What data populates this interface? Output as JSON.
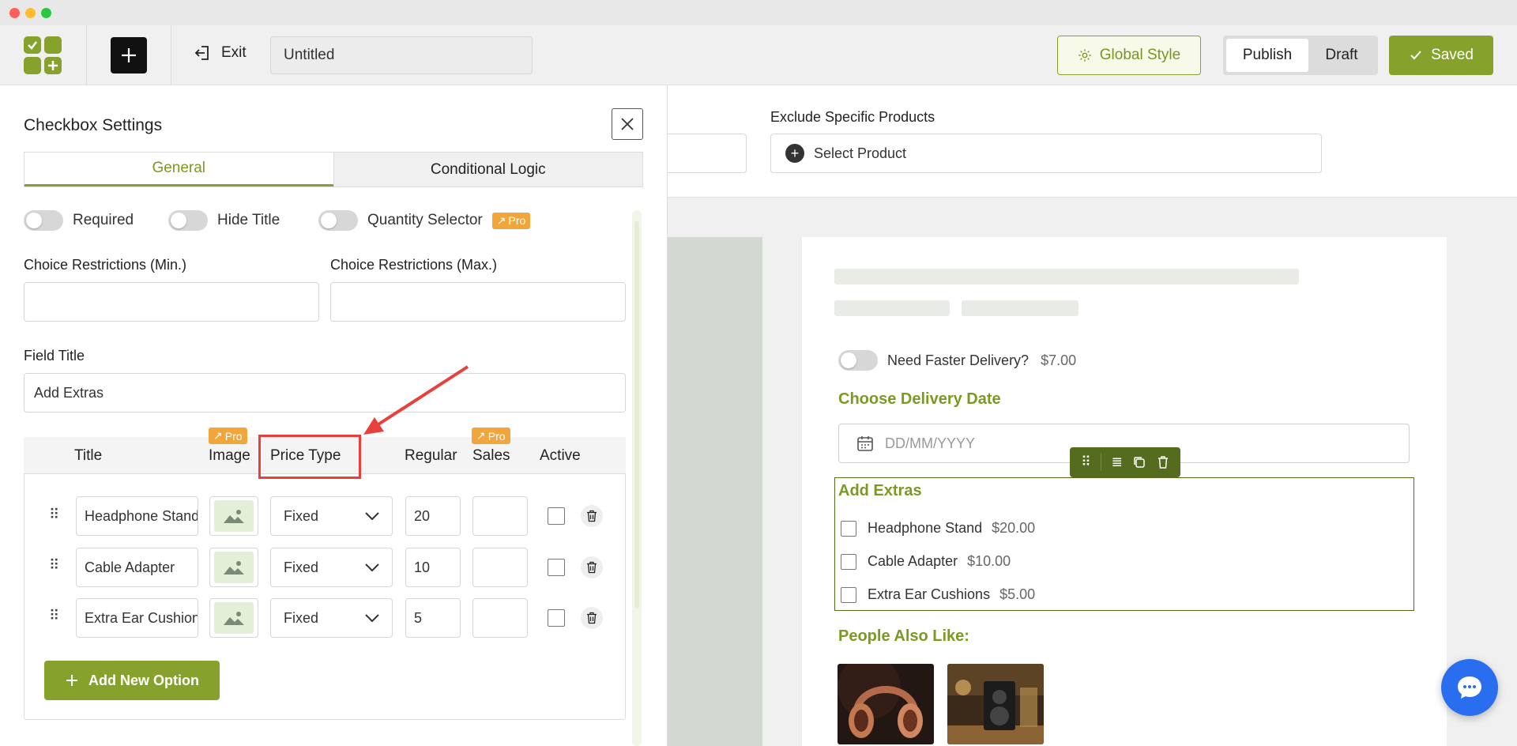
{
  "window": {
    "traffic_lights": [
      "#ff5f57",
      "#febc2e",
      "#28c840"
    ]
  },
  "topbar": {
    "exit_label": "Exit",
    "document_title": "Untitled",
    "global_style_label": "Global Style",
    "publish_label": "Publish",
    "draft_label": "Draft",
    "saved_label": "Saved"
  },
  "colors": {
    "accent": "#87a22c",
    "accent_dark": "#556b1e",
    "pro_badge": "#f0a63a",
    "highlight": "#e8403a",
    "chat": "#2a6ef0"
  },
  "filters": {
    "exclude_label": "Exclude Specific Products",
    "select_product_placeholder": "Select Product"
  },
  "panel": {
    "title": "Checkbox Settings",
    "tabs": [
      {
        "label": "General",
        "active": true
      },
      {
        "label": "Conditional Logic",
        "active": false
      }
    ],
    "toggles": [
      {
        "label": "Required",
        "on": false
      },
      {
        "label": "Hide Title",
        "on": false
      },
      {
        "label": "Quantity Selector",
        "on": false,
        "badge": "Pro"
      }
    ],
    "choice_min_label": "Choice Restrictions (Min.)",
    "choice_min_value": "",
    "choice_max_label": "Choice Restrictions (Max.)",
    "choice_max_value": "",
    "field_title_label": "Field Title",
    "field_title_value": "Add Extras",
    "table": {
      "headers": {
        "title": "Title",
        "image": "Image",
        "price_type": "Price Type",
        "regular": "Regular",
        "sales": "Sales",
        "active": "Active"
      },
      "image_badge": "Pro",
      "sales_badge": "Pro",
      "rows": [
        {
          "title": "Headphone Stand",
          "price_type": "Fixed",
          "regular": "20",
          "sales": "",
          "active": false
        },
        {
          "title": "Cable Adapter",
          "price_type": "Fixed",
          "regular": "10",
          "sales": "",
          "active": false
        },
        {
          "title": "Extra Ear Cushions",
          "price_type": "Fixed",
          "regular": "5",
          "sales": "",
          "active": false
        }
      ]
    },
    "add_option_label": "Add New Option"
  },
  "preview": {
    "delivery_toggle_label": "Need Faster Delivery?",
    "delivery_toggle_price": "$7.00",
    "delivery_date_title": "Choose Delivery Date",
    "date_placeholder": "DD/MM/YYYY",
    "extras_title": "Add Extras",
    "extras": [
      {
        "label": "Headphone Stand",
        "price": "$20.00"
      },
      {
        "label": "Cable Adapter",
        "price": "$10.00"
      },
      {
        "label": "Extra Ear Cushions",
        "price": "$5.00"
      }
    ],
    "people_also_like_title": "People Also Like:"
  }
}
